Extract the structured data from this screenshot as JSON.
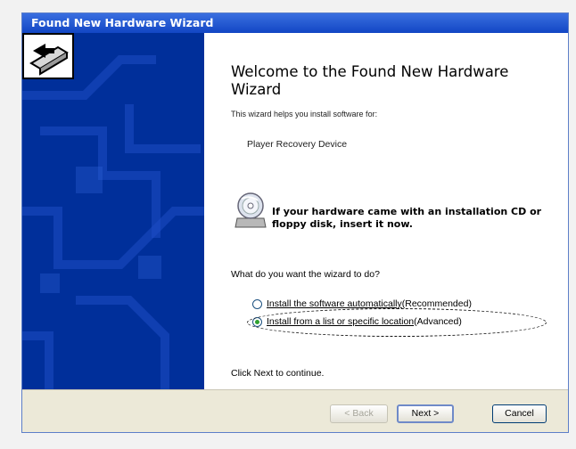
{
  "window": {
    "title": "Found New Hardware Wizard"
  },
  "content": {
    "heading": "Welcome to the Found New Hardware Wizard",
    "intro": "This wizard helps you install software for:",
    "device_name": "Player Recovery Device",
    "cd_prompt": "If your hardware came with an installation CD or floppy disk, insert it now.",
    "question": "What do you want the wizard to do?",
    "options": [
      {
        "label_underlined": "Install the software automatically",
        "label_rest": " (Recommended)",
        "selected": false
      },
      {
        "label_underlined": "Install from a list or specific location",
        "label_rest": " (Advanced)",
        "selected": true
      }
    ],
    "continue_text": "Click Next to continue."
  },
  "buttons": {
    "back": "< Back",
    "next": "Next >",
    "cancel": "Cancel",
    "back_enabled": false
  },
  "colors": {
    "titlebar": "#1246c4",
    "sidebar": "#002f9a",
    "footer": "#ece9d8"
  },
  "icons": [
    "hardware-wizard-icon",
    "cd-disc-icon",
    "radio-button-icon"
  ]
}
